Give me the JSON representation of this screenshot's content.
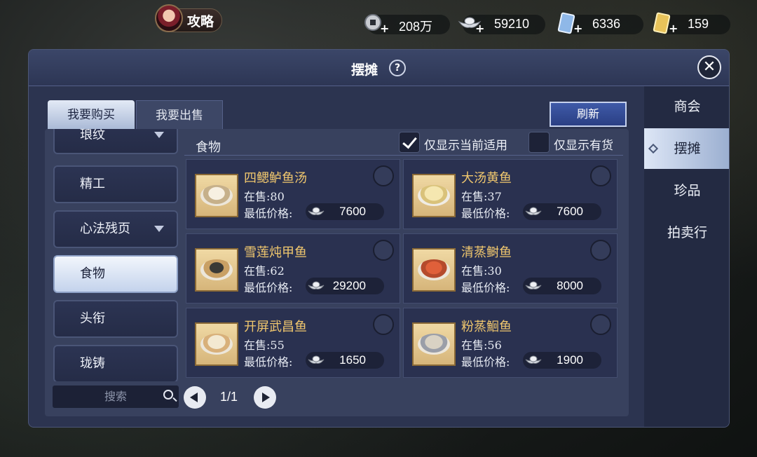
{
  "topbar": {
    "guide_label": "攻略",
    "currencies": [
      {
        "icon": "coin-icon",
        "value": "208万"
      },
      {
        "icon": "silver-ingot-icon",
        "value": "59210"
      },
      {
        "icon": "blue-ticket-icon",
        "value": "6336"
      },
      {
        "icon": "gold-ticket-icon",
        "value": "159"
      }
    ]
  },
  "panel": {
    "title": "摆摊",
    "close_icon": "close-icon",
    "side_tabs": [
      {
        "label": "商会",
        "active": false
      },
      {
        "label": "摆摊",
        "active": true
      },
      {
        "label": "珍品",
        "active": false
      },
      {
        "label": "拍卖行",
        "active": false
      }
    ],
    "tabs": {
      "buy": "我要购买",
      "sell": "我要出售"
    },
    "refresh": "刷新",
    "categories": [
      {
        "label": "琅纹",
        "dropdown": true
      },
      {
        "label": "精工",
        "dropdown": false
      },
      {
        "label": "心法残页",
        "dropdown": true
      },
      {
        "label": "食物",
        "dropdown": false,
        "selected": true
      },
      {
        "label": "头衔",
        "dropdown": false
      },
      {
        "label": "珑铸",
        "dropdown": false
      }
    ],
    "search_placeholder": "搜索",
    "pager": "1/1",
    "list": {
      "header": "食物",
      "filter_applicable": "仅显示当前适用",
      "filter_applicable_checked": true,
      "filter_instock": "仅显示有货",
      "filter_instock_checked": false
    },
    "items": [
      {
        "name": "四鳃鲈鱼汤",
        "stock": "在售:80",
        "price_label": "最低价格:",
        "price": "7600"
      },
      {
        "name": "大汤黄鱼",
        "stock": "在售:37",
        "price_label": "最低价格:",
        "price": "7600"
      },
      {
        "name": "雪莲炖甲鱼",
        "stock": "在售:62",
        "price_label": "最低价格:",
        "price": "29200"
      },
      {
        "name": "清蒸鲥鱼",
        "stock": "在售:30",
        "price_label": "最低价格:",
        "price": "8000"
      },
      {
        "name": "开屏武昌鱼",
        "stock": "在售:55",
        "price_label": "最低价格:",
        "price": "1650"
      },
      {
        "name": "粉蒸鮰鱼",
        "stock": "在售:56",
        "price_label": "最低价格:",
        "price": "1900"
      }
    ]
  }
}
